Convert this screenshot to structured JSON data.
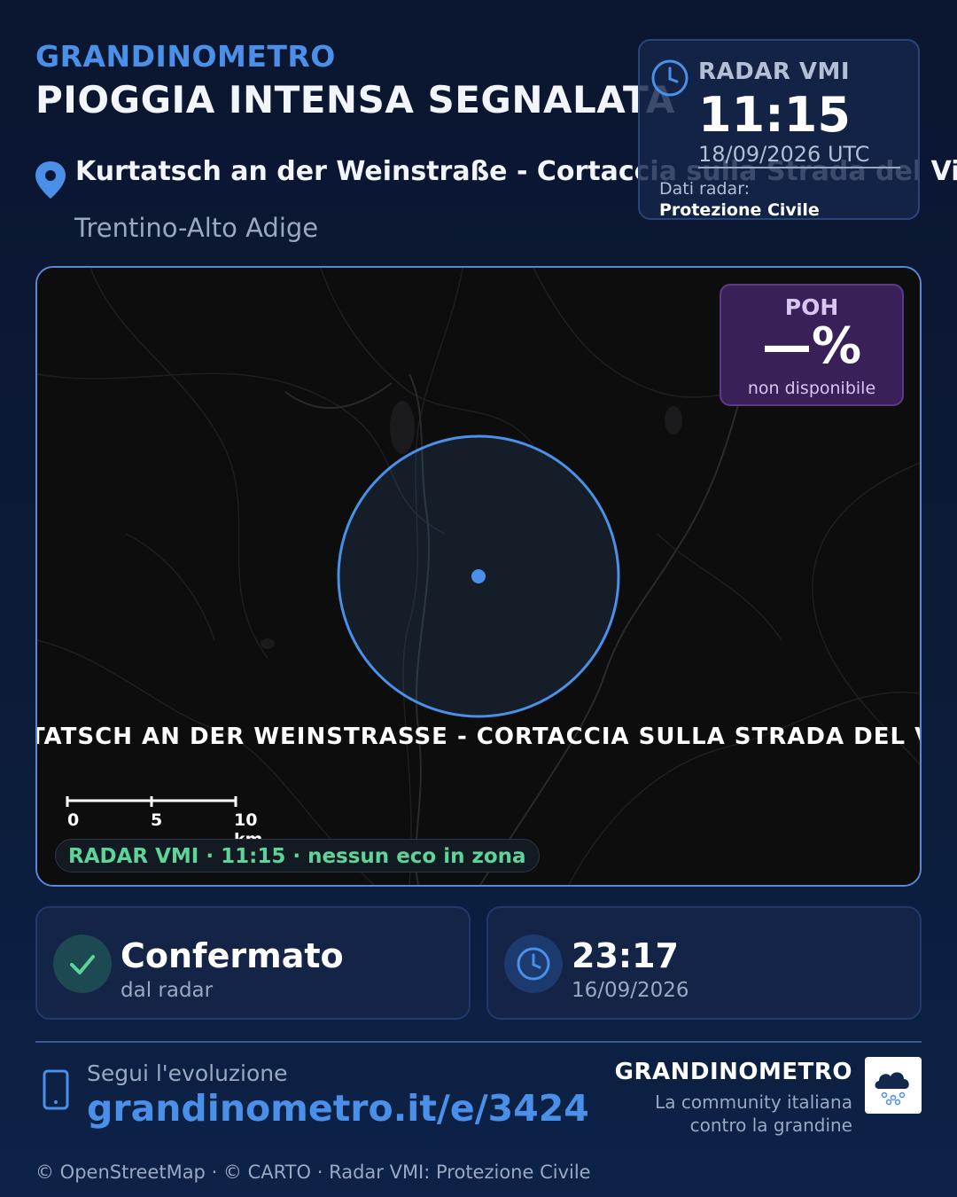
{
  "brand": "GRANDINOMETRO",
  "headline": "PIOGGIA INTENSA SEGNALATA",
  "location": {
    "name": "Kurtatsch an der Weinstraße - Cortaccia sulla Strada del Vino",
    "region": "Trentino-Alto Adige",
    "icon": "map-pin-icon"
  },
  "radar_card": {
    "label": "RADAR VMI",
    "time": "11:15",
    "date": "18/09/2026 UTC",
    "source_label": "Dati radar:",
    "source_name": "Protezione Civile",
    "icon": "clock-icon"
  },
  "map": {
    "poh_label": "POH",
    "poh_value": "—%",
    "poh_note": "non disponibile",
    "banner": "KURTATSCH AN DER WEINSTRASSE - CORTACCIA SULLA STRADA DEL VINO",
    "scale": {
      "labels": [
        "0",
        "5",
        "10 km"
      ]
    },
    "status_pill": "RADAR VMI · 11:15 · nessun eco in zona"
  },
  "cards": {
    "confirmed": {
      "title": "Confermato",
      "subtitle": "dal radar",
      "icon": "check-icon"
    },
    "report_time": {
      "title": "23:17",
      "subtitle": "16/09/2026",
      "icon": "clock-icon"
    }
  },
  "footer": {
    "follow": "Segui l'evoluzione",
    "url": "grandinometro.it/e/3424",
    "brand": "GRANDINOMETRO",
    "tagline_1": "La community italiana",
    "tagline_2": "contro la grandine",
    "credits": "© OpenStreetMap · © CARTO · Radar VMI: Protezione Civile"
  },
  "colors": {
    "accent": "#4a90e8",
    "background": "#0b1630",
    "card": "#142447",
    "status_green": "#5ed49a",
    "poh_purple": "#3a2058"
  }
}
